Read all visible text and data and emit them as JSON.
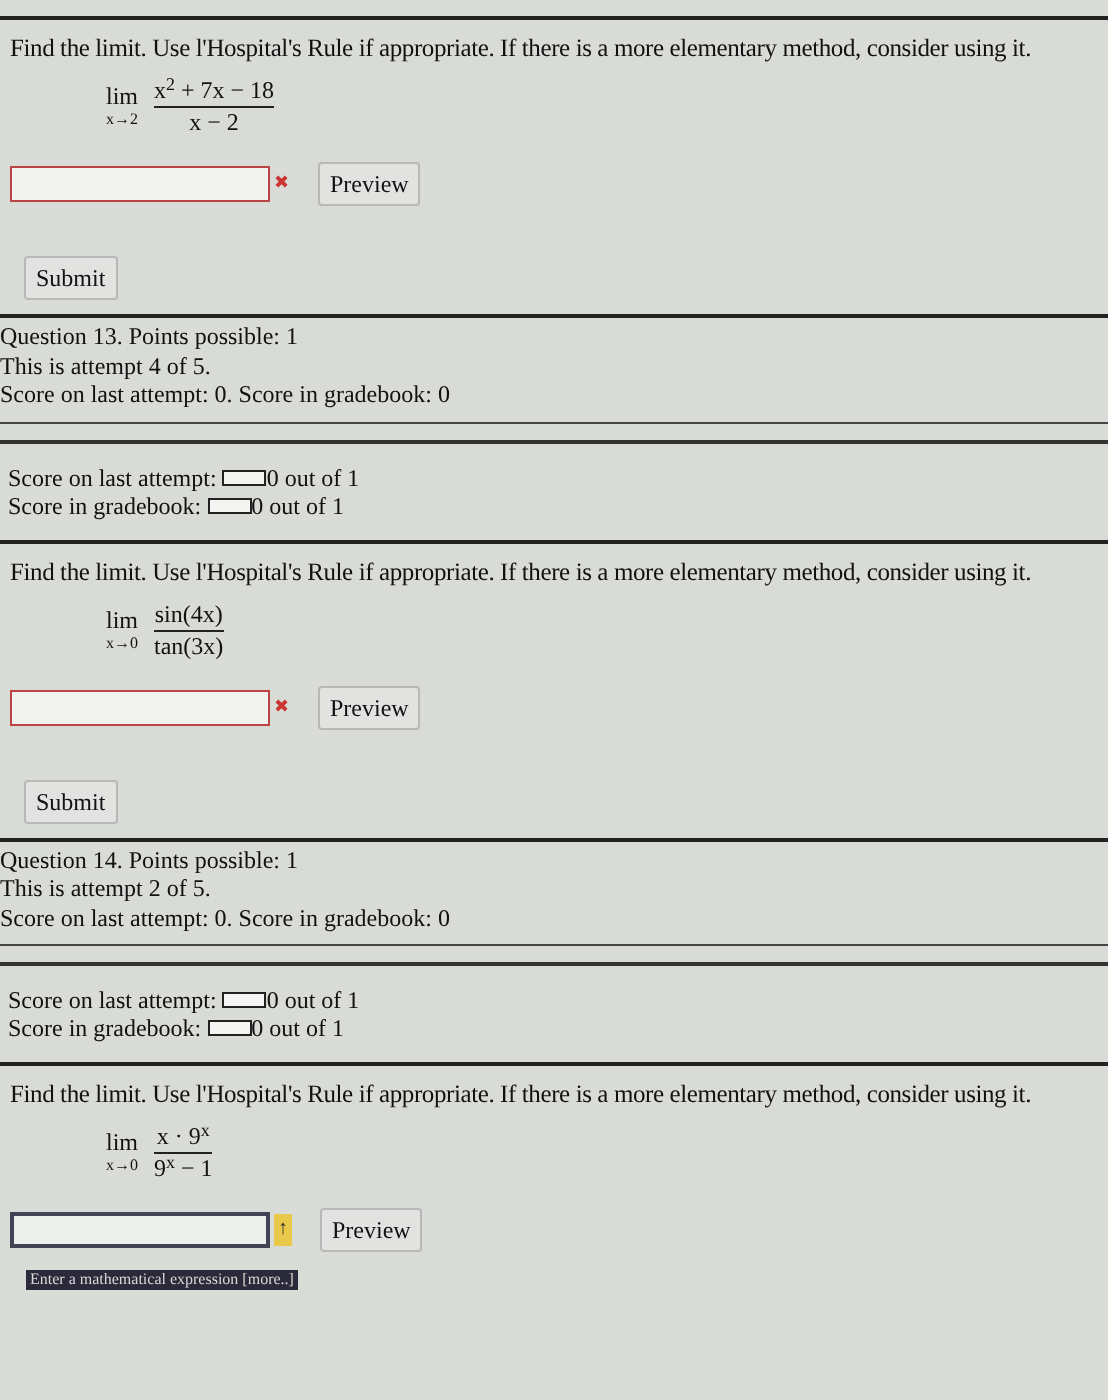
{
  "blocks": [
    {
      "kind": "problem",
      "prompt": "Find the limit. Use l'Hospital's Rule if appropriate. If there is a more elementary method, consider using it.",
      "lim": "lim",
      "approach": "x→2",
      "numerator": "x$^{2}$ + 7x − 18",
      "denominator": "x − 2",
      "answer": {
        "kind": "error",
        "mark": "✖"
      },
      "preview": "Preview",
      "submit": "Submit"
    },
    {
      "kind": "info",
      "lines": [
        "Question 13. Points possible: 1",
        "This is attempt 4 of 5.",
        "Score on last attempt: 0. Score in gradebook: 0"
      ]
    },
    {
      "kind": "scores",
      "rows": [
        {
          "label": "Score on last attempt:",
          "level": 0,
          "value": "0 out of 1"
        },
        {
          "label": "Score in gradebook:",
          "level": 0,
          "value": "0 out of 1"
        }
      ]
    },
    {
      "kind": "problem",
      "prompt": "Find the limit. Use l'Hospital's Rule if appropriate. If there is a more elementary method, consider using it.",
      "lim": "lim",
      "approach": "x→0",
      "numerator": "sin(4x)",
      "denominator": "tan(3x)",
      "answer": {
        "kind": "error",
        "mark": "✖"
      },
      "preview": "Preview",
      "submit": "Submit"
    },
    {
      "kind": "info",
      "lines": [
        "Question 14. Points possible: 1",
        "This is attempt 2 of 5.",
        "Score on last attempt: 0. Score in gradebook: 0"
      ]
    },
    {
      "kind": "scores",
      "rows": [
        {
          "label": "Score on last attempt:",
          "level": 0,
          "value": "0 out of 1"
        },
        {
          "label": "Score in gradebook:",
          "level": 0,
          "value": "0 out of 1"
        }
      ]
    },
    {
      "kind": "problem",
      "prompt": "Find the limit. Use l'Hospital's Rule if appropriate. If there is a more elementary method, consider using it.",
      "lim": "lim",
      "approach": "x→0",
      "numerator": "x · 9$^{x}$",
      "denominator": "9$^{x}$ − 1",
      "answer": {
        "kind": "typing",
        "mark": "↑",
        "hint": "Enter a mathematical expression [more..]"
      },
      "preview": "Preview"
    }
  ]
}
